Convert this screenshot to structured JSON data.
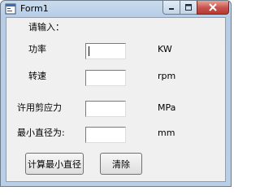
{
  "window": {
    "title": "Form1",
    "icon": "form-app-icon"
  },
  "titlebar_buttons": {
    "minimize_icon": "minimize-icon",
    "maximize_icon": "maximize-icon",
    "close_icon": "close-icon"
  },
  "form": {
    "prompt_label": "请输入：",
    "fields": [
      {
        "label": "功率",
        "value": "",
        "unit": "KW"
      },
      {
        "label": "转速",
        "value": "",
        "unit": "rpm"
      },
      {
        "label": "许用剪应力",
        "value": "",
        "unit": "MPa"
      },
      {
        "label": "最小直径为:",
        "value": "",
        "unit": "mm"
      }
    ],
    "buttons": {
      "calculate_label": "计算最小直径",
      "clear_label": "清除"
    }
  }
}
